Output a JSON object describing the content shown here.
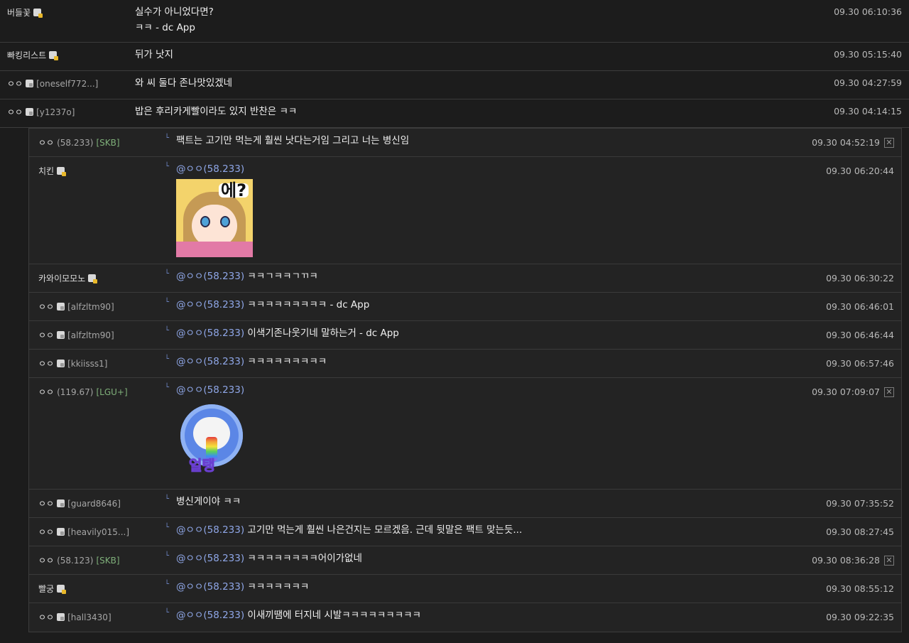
{
  "comments": [
    {
      "nick": "버들꽃",
      "badge": "gold",
      "uid": "",
      "ip": "",
      "isp": "",
      "lines": [
        "실수가 아니었다면?",
        "ㅋㅋ - dc App"
      ],
      "date": "09.30 06:10:36"
    },
    {
      "nick": "빠킹리스트",
      "badge": "gold",
      "uid": "",
      "ip": "",
      "isp": "",
      "lines": [
        "뒤가 낫지"
      ],
      "date": "09.30 05:15:40"
    },
    {
      "nick": "ㅇㅇ",
      "badge": "grey",
      "uid": "[oneself772...]",
      "ip": "",
      "isp": "",
      "lines": [
        "와 씨 둘다 존나맛있겠네"
      ],
      "date": "09.30 04:27:59"
    },
    {
      "nick": "ㅇㅇ",
      "badge": "grey",
      "uid": "[y1237o]",
      "ip": "",
      "isp": "",
      "lines": [
        "밥은 후리카게빨이라도 있지 반찬은 ㅋㅋ"
      ],
      "date": "09.30 04:14:15"
    }
  ],
  "replies": [
    {
      "nick": "ㅇㅇ",
      "ip": "(58.233)",
      "isp": "[SKB]",
      "mention": "",
      "text": "팩트는 고기만 먹는게 훨씬 낫다는거임 그리고 너는 병신임",
      "date": "09.30 04:52:19",
      "deletable": true
    },
    {
      "nick": "치킨",
      "badge": "gold",
      "mention": "@ㅇㅇ(58.233)",
      "text": "",
      "sticker": "에?",
      "date": "09.30 06:20:44"
    },
    {
      "nick": "카와이모모노",
      "badge": "gold",
      "mention": "@ㅇㅇ(58.233)",
      "text": "ㅋㅋㄱㅋㅋㄱㄲㅋ",
      "date": "09.30 06:30:22"
    },
    {
      "nick": "ㅇㅇ",
      "badge": "grey",
      "uid": "[alfzltm90]",
      "mention": "@ㅇㅇ(58.233)",
      "text": "ㅋㅋㅋㅋㅋㅋㅋㅋㅋ - dc App",
      "date": "09.30 06:46:01"
    },
    {
      "nick": "ㅇㅇ",
      "badge": "grey",
      "uid": "[alfzltm90]",
      "mention": "@ㅇㅇ(58.233)",
      "text": "이색기존나웃기네 말하는거 - dc App",
      "date": "09.30 06:46:44"
    },
    {
      "nick": "ㅇㅇ",
      "badge": "grey",
      "uid": "[kkiisss1]",
      "mention": "@ㅇㅇ(58.233)",
      "text": "ㅋㅋㅋㅋㅋㅋㅋㅋㅋ",
      "date": "09.30 06:57:46"
    },
    {
      "nick": "ㅇㅇ",
      "ip": "(119.67)",
      "isp": "[LGU+]",
      "mention": "@ㅇㅇ(58.233)",
      "text": "",
      "sticker": "얼탱",
      "date": "09.30 07:09:07",
      "deletable": true
    },
    {
      "nick": "ㅇㅇ",
      "badge": "grey",
      "uid": "[guard8646]",
      "mention": "",
      "text": "병신게이야 ㅋㅋ",
      "date": "09.30 07:35:52"
    },
    {
      "nick": "ㅇㅇ",
      "badge": "grey",
      "uid": "[heavily015...]",
      "mention": "@ㅇㅇ(58.233)",
      "text": "고기만 먹는게 훨씬 나은건지는 모르겠음. 근데 뒷말은 팩트 맞는듯...",
      "date": "09.30 08:27:45"
    },
    {
      "nick": "ㅇㅇ",
      "ip": "(58.123)",
      "isp": "[SKB]",
      "mention": "@ㅇㅇ(58.233)",
      "text": "ㅋㅋㅋㅋㅋㅋㅋㅋ어이가없네",
      "date": "09.30 08:36:28",
      "deletable": true
    },
    {
      "nick": "빨궁",
      "badge": "gold",
      "mention": "@ㅇㅇ(58.233)",
      "text": "ㅋㅋㅋㅋㅋㅋㅋ",
      "date": "09.30 08:55:12"
    },
    {
      "nick": "ㅇㅇ",
      "badge": "grey",
      "uid": "[hall3430]",
      "mention": "@ㅇㅇ(58.233)",
      "text": "이새끼땜에 터지네 시발ㅋㅋㅋㅋㅋㅋㅋㅋㅋ",
      "date": "09.30 09:22:35"
    }
  ],
  "labels": {
    "reply_arrow": "└",
    "delete": "✕"
  }
}
